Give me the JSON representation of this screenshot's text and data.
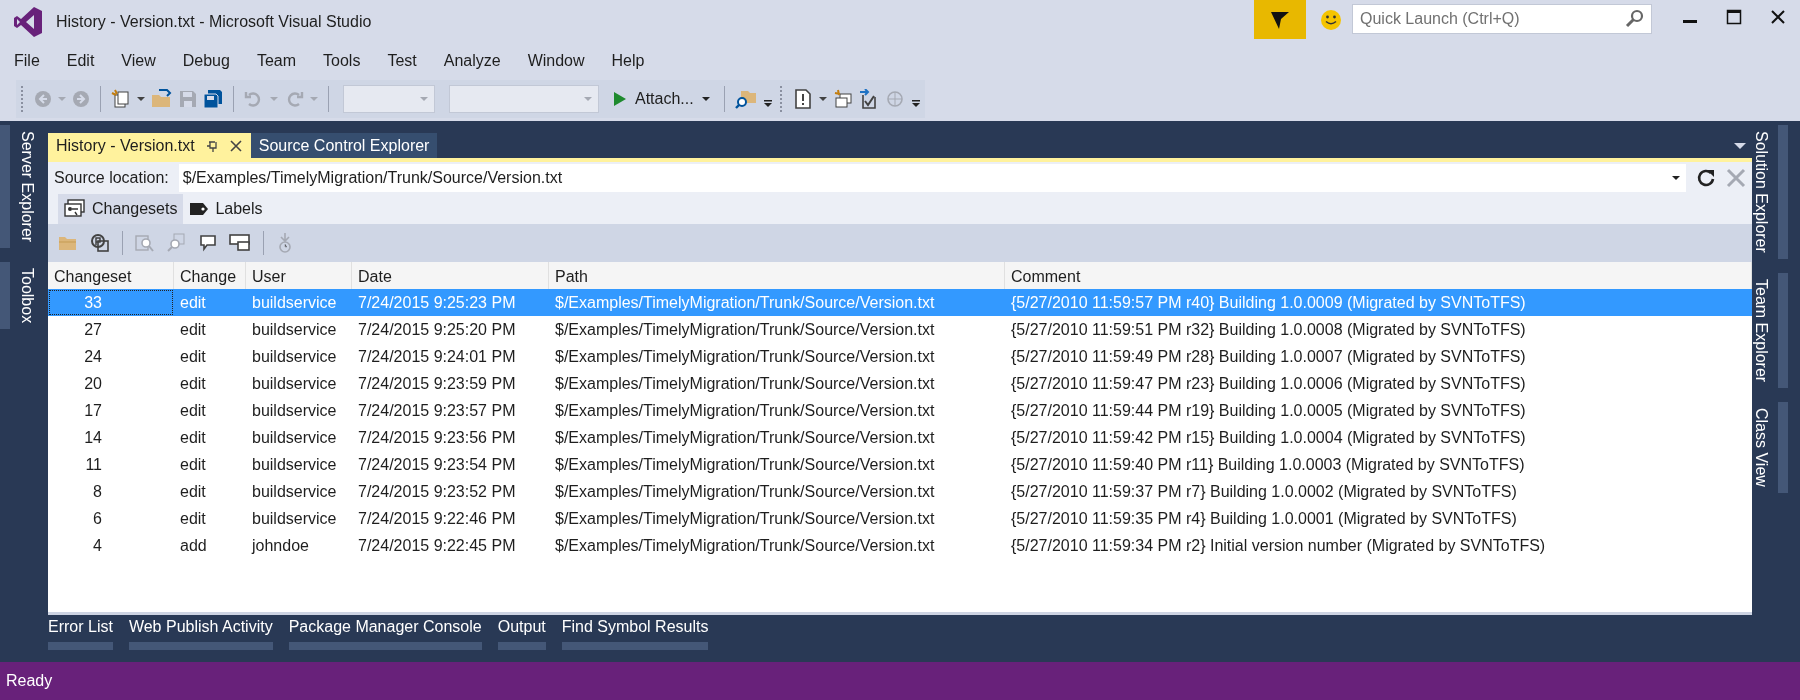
{
  "window": {
    "title": "History - Version.txt - Microsoft Visual Studio"
  },
  "quick_launch": {
    "placeholder": "Quick Launch (Ctrl+Q)"
  },
  "menu": [
    "File",
    "Edit",
    "View",
    "Debug",
    "Team",
    "Tools",
    "Test",
    "Analyze",
    "Window",
    "Help"
  ],
  "toolbar": [
    {
      "kind": "grip"
    },
    {
      "kind": "back",
      "disabled": true
    },
    {
      "kind": "dropdown",
      "disabled": true
    },
    {
      "kind": "forward",
      "disabled": true
    },
    {
      "kind": "separator"
    },
    {
      "kind": "new-project",
      "disabled": false
    },
    {
      "kind": "dropdown",
      "disabled": false
    },
    {
      "kind": "open",
      "disabled": false
    },
    {
      "kind": "save",
      "disabled": true
    },
    {
      "kind": "save-all",
      "disabled": false
    },
    {
      "kind": "separator"
    },
    {
      "kind": "undo",
      "disabled": true
    },
    {
      "kind": "dropdown",
      "disabled": true
    },
    {
      "kind": "redo",
      "disabled": true
    },
    {
      "kind": "dropdown",
      "disabled": true
    },
    {
      "kind": "separator"
    },
    {
      "kind": "config-combo",
      "disabled": true
    },
    {
      "kind": "platform-combo",
      "disabled": true
    },
    {
      "kind": "start",
      "label": "Attach...",
      "disabled": false
    },
    {
      "kind": "separator"
    },
    {
      "kind": "find",
      "disabled": false
    },
    {
      "kind": "overflow"
    },
    {
      "kind": "grip"
    },
    {
      "kind": "task",
      "disabled": false
    },
    {
      "kind": "dropdown",
      "disabled": false
    },
    {
      "kind": "new-item",
      "disabled": false
    },
    {
      "kind": "check-in",
      "disabled": false
    },
    {
      "kind": "web",
      "disabled": true
    },
    {
      "kind": "overflow"
    }
  ],
  "left_side_tabs": [
    "Server Explorer",
    "Toolbox"
  ],
  "right_side_tabs": [
    "Solution Explorer",
    "Team Explorer",
    "Class View"
  ],
  "document_tabs": [
    {
      "label": "History - Version.txt",
      "selected": true
    },
    {
      "label": "Source Control Explorer",
      "selected": false
    }
  ],
  "history": {
    "source_label": "Source location:",
    "source_value": "$/Examples/TimelyMigration/Trunk/Source/Version.txt",
    "subtabs": [
      {
        "label": "Changesets",
        "selected": true
      },
      {
        "label": "Labels",
        "selected": false
      }
    ],
    "toolbar": [
      {
        "kind": "folder",
        "disabled": false
      },
      {
        "kind": "compare",
        "disabled": false
      },
      {
        "kind": "separator"
      },
      {
        "kind": "details",
        "disabled": true
      },
      {
        "kind": "search",
        "disabled": true
      },
      {
        "kind": "comment",
        "disabled": false
      },
      {
        "kind": "layout",
        "disabled": false
      },
      {
        "kind": "separator"
      },
      {
        "kind": "rollback",
        "disabled": true
      }
    ],
    "columns": [
      "Changeset",
      "Change",
      "User",
      "Date",
      "Path",
      "Comment"
    ],
    "rows": [
      {
        "cells": [
          "33",
          "edit",
          "buildservice",
          "7/24/2015 9:25:23 PM",
          "$/Examples/TimelyMigration/Trunk/Source/Version.txt",
          "{5/27/2010 11:59:57 PM r40} Building 1.0.0009 (Migrated by SVNToTFS)"
        ],
        "selected": true
      },
      {
        "cells": [
          "27",
          "edit",
          "buildservice",
          "7/24/2015 9:25:20 PM",
          "$/Examples/TimelyMigration/Trunk/Source/Version.txt",
          "{5/27/2010 11:59:51 PM r32} Building 1.0.0008 (Migrated by SVNToTFS)"
        ],
        "selected": false
      },
      {
        "cells": [
          "24",
          "edit",
          "buildservice",
          "7/24/2015 9:24:01 PM",
          "$/Examples/TimelyMigration/Trunk/Source/Version.txt",
          "{5/27/2010 11:59:49 PM r28} Building 1.0.0007 (Migrated by SVNToTFS)"
        ],
        "selected": false
      },
      {
        "cells": [
          "20",
          "edit",
          "buildservice",
          "7/24/2015 9:23:59 PM",
          "$/Examples/TimelyMigration/Trunk/Source/Version.txt",
          "{5/27/2010 11:59:47 PM r23} Building 1.0.0006 (Migrated by SVNToTFS)"
        ],
        "selected": false
      },
      {
        "cells": [
          "17",
          "edit",
          "buildservice",
          "7/24/2015 9:23:57 PM",
          "$/Examples/TimelyMigration/Trunk/Source/Version.txt",
          "{5/27/2010 11:59:44 PM r19} Building 1.0.0005 (Migrated by SVNToTFS)"
        ],
        "selected": false
      },
      {
        "cells": [
          "14",
          "edit",
          "buildservice",
          "7/24/2015 9:23:56 PM",
          "$/Examples/TimelyMigration/Trunk/Source/Version.txt",
          "{5/27/2010 11:59:42 PM r15} Building 1.0.0004 (Migrated by SVNToTFS)"
        ],
        "selected": false
      },
      {
        "cells": [
          "11",
          "edit",
          "buildservice",
          "7/24/2015 9:23:54 PM",
          "$/Examples/TimelyMigration/Trunk/Source/Version.txt",
          "{5/27/2010 11:59:40 PM r11} Building 1.0.0003 (Migrated by SVNToTFS)"
        ],
        "selected": false
      },
      {
        "cells": [
          "8",
          "edit",
          "buildservice",
          "7/24/2015 9:23:52 PM",
          "$/Examples/TimelyMigration/Trunk/Source/Version.txt",
          "{5/27/2010 11:59:37 PM r7} Building 1.0.0002 (Migrated by SVNToTFS)"
        ],
        "selected": false
      },
      {
        "cells": [
          "6",
          "edit",
          "buildservice",
          "7/24/2015 9:22:46 PM",
          "$/Examples/TimelyMigration/Trunk/Source/Version.txt",
          "{5/27/2010 11:59:35 PM r4} Building 1.0.0001 (Migrated by SVNToTFS)"
        ],
        "selected": false
      },
      {
        "cells": [
          "4",
          "add",
          "johndoe",
          "7/24/2015 9:22:45 PM",
          "$/Examples/TimelyMigration/Trunk/Source/Version.txt",
          "{5/27/2010 11:59:34 PM r2} Initial version number (Migrated by SVNToTFS)"
        ],
        "selected": false
      }
    ]
  },
  "tool_tabs": [
    "Error List",
    "Web Publish Activity",
    "Package Manager Console",
    "Output",
    "Find Symbol Results"
  ],
  "status_bar": {
    "text": "Ready"
  }
}
